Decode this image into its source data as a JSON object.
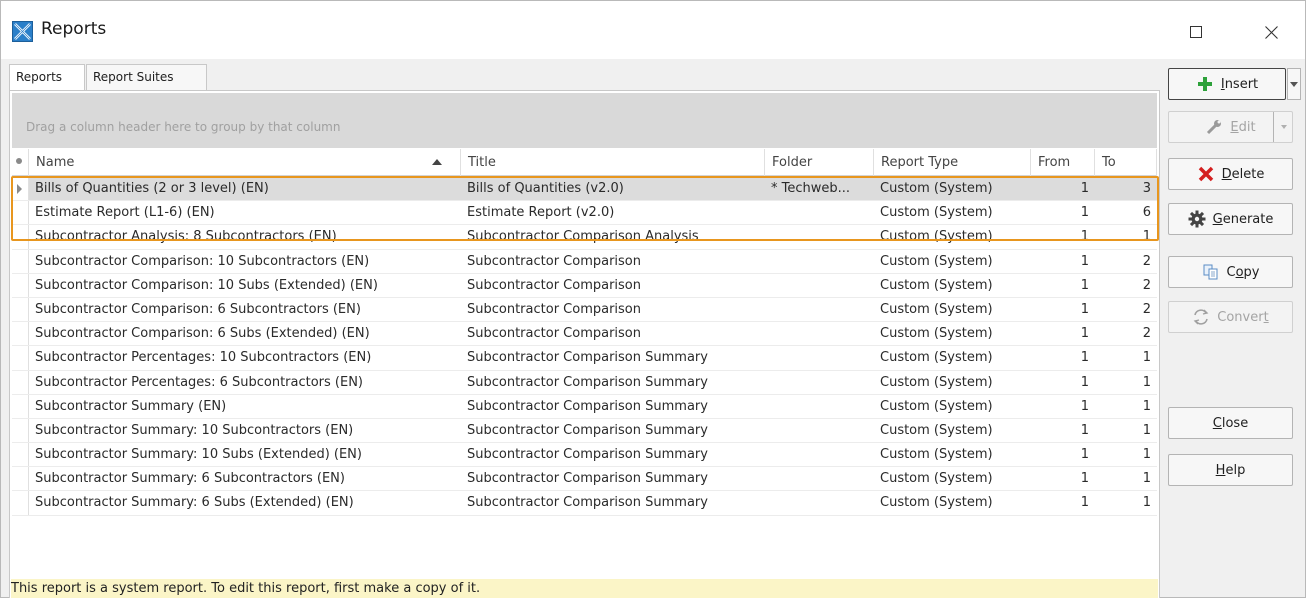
{
  "window": {
    "title": "Reports"
  },
  "tabs": [
    {
      "label": "Reports",
      "active": true
    },
    {
      "label": "Report Suites",
      "active": false
    }
  ],
  "grid": {
    "group_hint": "Drag a column header here to group by that column",
    "columns": [
      "Name",
      "Title",
      "Folder",
      "Report Type",
      "From",
      "To"
    ],
    "sorted_column": "Name",
    "rows": [
      {
        "name": "Bills of Quantities (2 or 3 level) (EN)",
        "title": "Bills of Quantities (v2.0)",
        "folder": "* Techweb...",
        "type": "Custom (System)",
        "from": "1",
        "to": "3"
      },
      {
        "name": "Estimate Report (L1-6) (EN)",
        "title": "Estimate Report (v2.0)",
        "folder": "",
        "type": "Custom (System)",
        "from": "1",
        "to": "6"
      },
      {
        "name": "Subcontractor Analysis: 8 Subcontractors (EN)",
        "title": "Subcontractor Comparison Analysis",
        "folder": "",
        "type": "Custom (System)",
        "from": "1",
        "to": "1"
      },
      {
        "name": "Subcontractor Comparison: 10 Subcontractors (EN)",
        "title": "Subcontractor Comparison",
        "folder": "",
        "type": "Custom (System)",
        "from": "1",
        "to": "2"
      },
      {
        "name": "Subcontractor Comparison: 10 Subs (Extended) (EN)",
        "title": "Subcontractor Comparison",
        "folder": "",
        "type": "Custom (System)",
        "from": "1",
        "to": "2"
      },
      {
        "name": "Subcontractor Comparison: 6 Subcontractors (EN)",
        "title": "Subcontractor Comparison",
        "folder": "",
        "type": "Custom (System)",
        "from": "1",
        "to": "2"
      },
      {
        "name": "Subcontractor Comparison: 6 Subs (Extended) (EN)",
        "title": "Subcontractor Comparison",
        "folder": "",
        "type": "Custom (System)",
        "from": "1",
        "to": "2"
      },
      {
        "name": "Subcontractor Percentages: 10 Subcontractors (EN)",
        "title": "Subcontractor Comparison Summary",
        "folder": "",
        "type": "Custom (System)",
        "from": "1",
        "to": "1"
      },
      {
        "name": "Subcontractor Percentages: 6 Subcontractors (EN)",
        "title": "Subcontractor Comparison Summary",
        "folder": "",
        "type": "Custom (System)",
        "from": "1",
        "to": "1"
      },
      {
        "name": "Subcontractor Summary (EN)",
        "title": "Subcontractor Comparison Summary",
        "folder": "",
        "type": "Custom (System)",
        "from": "1",
        "to": "1"
      },
      {
        "name": "Subcontractor Summary: 10 Subcontractors (EN)",
        "title": "Subcontractor Comparison Summary",
        "folder": "",
        "type": "Custom (System)",
        "from": "1",
        "to": "1"
      },
      {
        "name": "Subcontractor Summary: 10 Subs (Extended) (EN)",
        "title": "Subcontractor Comparison Summary",
        "folder": "",
        "type": "Custom (System)",
        "from": "1",
        "to": "1"
      },
      {
        "name": "Subcontractor Summary: 6 Subcontractors (EN)",
        "title": "Subcontractor Comparison Summary",
        "folder": "",
        "type": "Custom (System)",
        "from": "1",
        "to": "1"
      },
      {
        "name": "Subcontractor Summary: 6 Subs (Extended) (EN)",
        "title": "Subcontractor Comparison Summary",
        "folder": "",
        "type": "Custom (System)",
        "from": "1",
        "to": "1"
      }
    ]
  },
  "status": {
    "text": "This report is a system report. To edit this report, first make a copy of it."
  },
  "buttons": {
    "insert": {
      "prefix": "",
      "key": "I",
      "rest": "nsert",
      "icon": "plus-icon"
    },
    "edit": {
      "key": "E",
      "rest": "dit",
      "icon": "wrench-icon"
    },
    "delete": {
      "key": "D",
      "rest": "elete",
      "icon": "red-x-icon"
    },
    "generate": {
      "key": "G",
      "rest": "enerate",
      "icon": "gear-icon"
    },
    "copy": {
      "pre": "C",
      "key": "o",
      "rest": "py",
      "icon": "copy-icon"
    },
    "convert": {
      "pre": "Conver",
      "key": "t",
      "rest": "",
      "icon": "convert-icon"
    },
    "close": {
      "key": "C",
      "rest": "lose"
    },
    "help": {
      "key": "H",
      "rest": "elp"
    }
  },
  "colors": {
    "highlight": "#e8961e",
    "status_bg": "#fbf5c7",
    "selected_row": "#dcdcdc"
  }
}
